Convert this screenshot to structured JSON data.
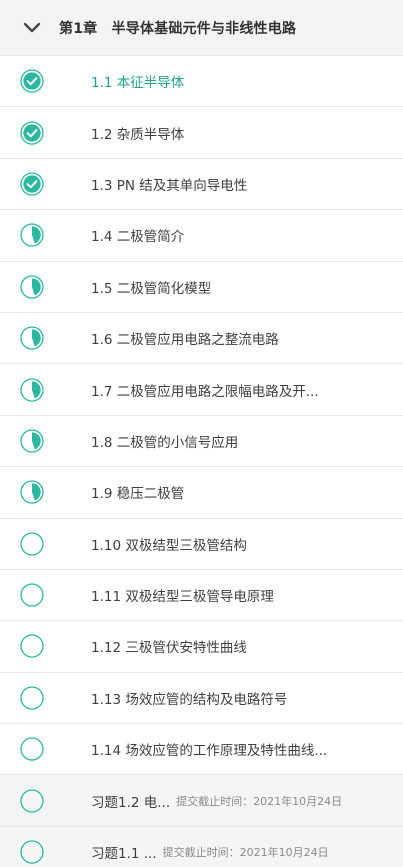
{
  "chapter": {
    "title": "第1章　半导体基础元件与非线性电路"
  },
  "colors": {
    "accent": "#2bb7a0",
    "complete_check": "#ffffff",
    "divider": "#e9e9e9"
  },
  "items": [
    {
      "label": "1.1 本征半导体",
      "status": "complete",
      "icon": "check-circle-icon",
      "active": true
    },
    {
      "label": "1.2 杂质半导体",
      "status": "complete",
      "icon": "check-circle-icon"
    },
    {
      "label": "1.3 PN 结及其单向导电性",
      "status": "complete",
      "icon": "check-circle-icon"
    },
    {
      "label": "1.4 二极管简介",
      "status": "in-progress",
      "icon": "partial-progress-icon"
    },
    {
      "label": "1.5 二极管简化模型",
      "status": "in-progress",
      "icon": "partial-progress-icon"
    },
    {
      "label": "1.6 二极管应用电路之整流电路",
      "status": "in-progress",
      "icon": "partial-progress-icon"
    },
    {
      "label": "1.7 二极管应用电路之限幅电路及开...",
      "status": "in-progress",
      "icon": "partial-progress-icon"
    },
    {
      "label": "1.8 二极管的小信号应用",
      "status": "in-progress",
      "icon": "partial-progress-icon"
    },
    {
      "label": "1.9 稳压二极管",
      "status": "in-progress",
      "icon": "partial-progress-icon"
    },
    {
      "label": "1.10 双极结型三极管结构",
      "status": "not-started",
      "icon": "empty-circle-icon"
    },
    {
      "label": "1.11 双极结型三极管导电原理",
      "status": "not-started",
      "icon": "empty-circle-icon"
    },
    {
      "label": "1.12 三极管伏安特性曲线",
      "status": "not-started",
      "icon": "empty-circle-icon"
    },
    {
      "label": "1.13 场效应管的结构及电路符号",
      "status": "not-started",
      "icon": "empty-circle-icon"
    },
    {
      "label": "1.14 场效应管的工作原理及特性曲线...",
      "status": "not-started",
      "icon": "empty-circle-icon"
    }
  ],
  "exercises": [
    {
      "title": "习题1.2 电...",
      "deadline": "提交截止时间：2021年10月24日",
      "status": "not-started",
      "icon": "empty-circle-icon"
    },
    {
      "title": "习题1.1 ...",
      "deadline": "提交截止时间：2021年10月24日",
      "status": "not-started",
      "icon": "empty-circle-icon"
    }
  ]
}
